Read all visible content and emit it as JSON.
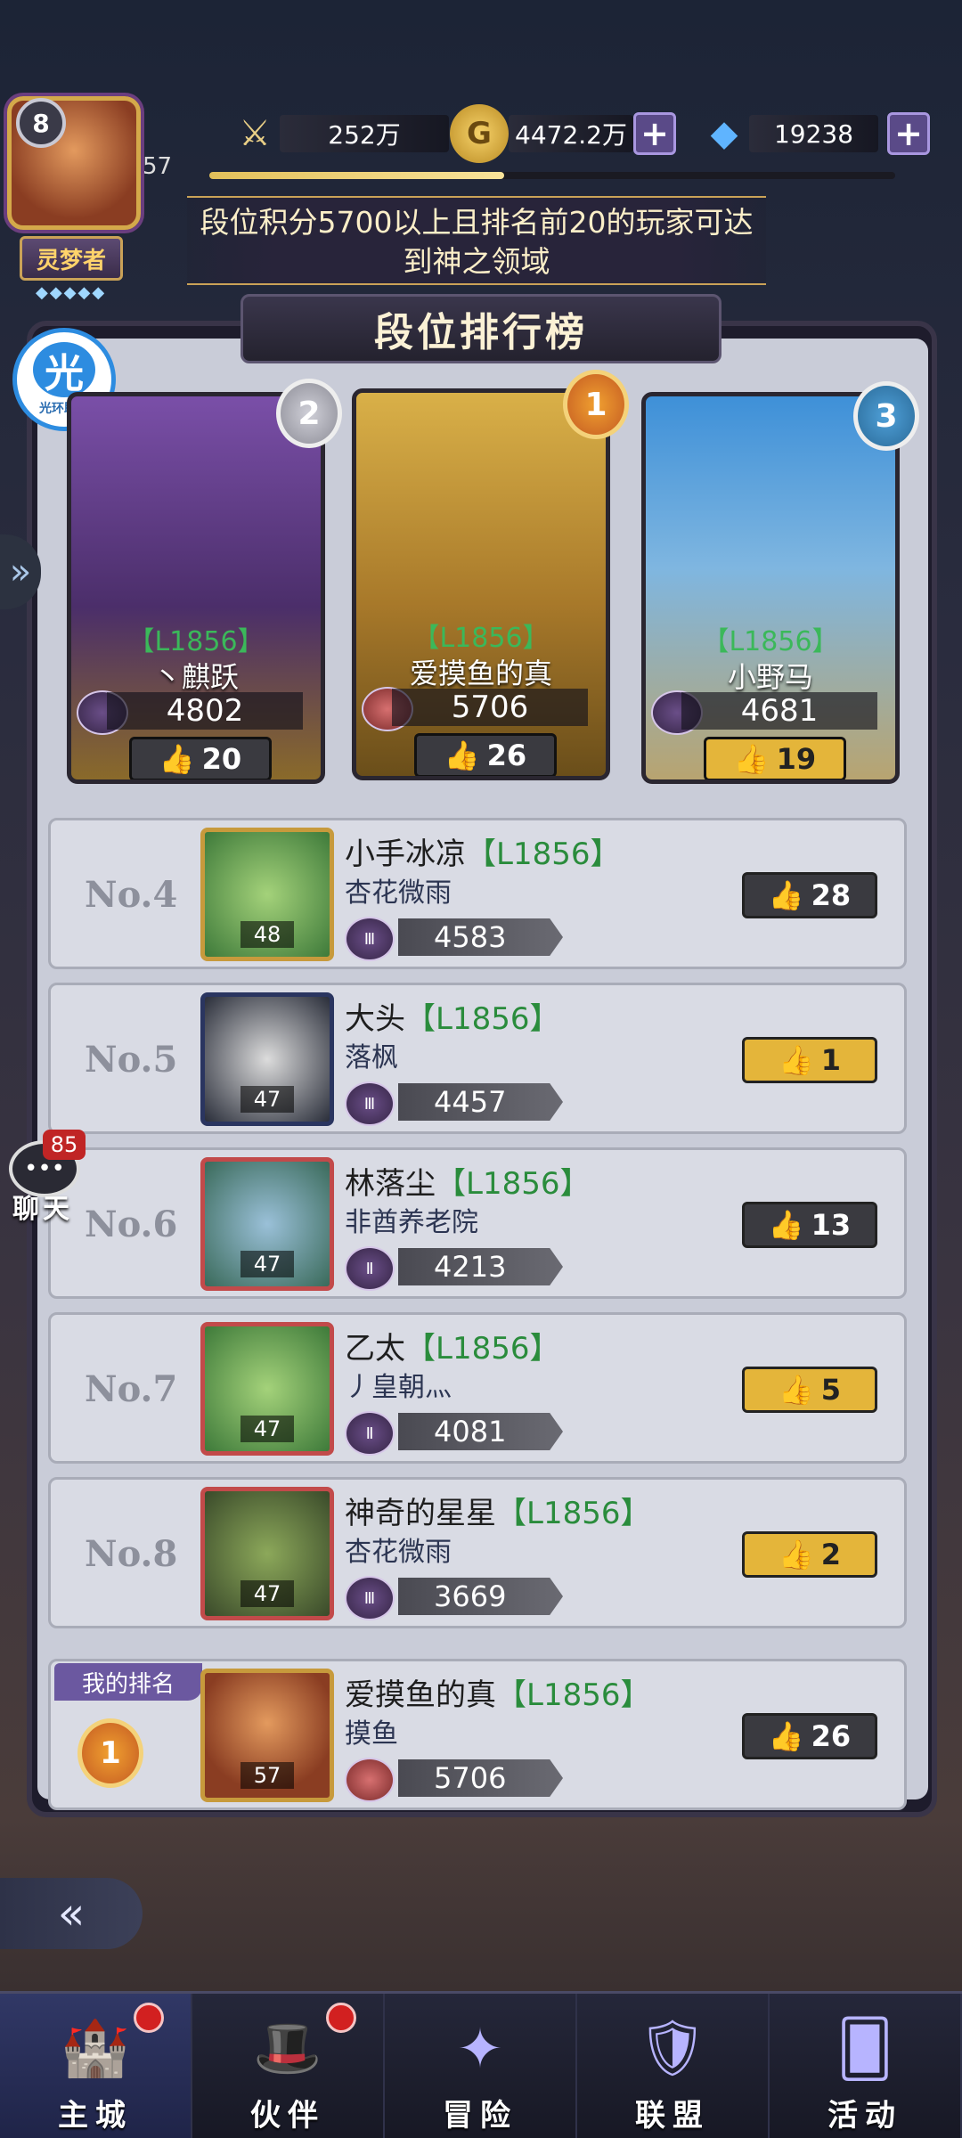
{
  "player": {
    "badge_level": "8",
    "exp_level": "57",
    "title": "灵梦者",
    "title_stars": "◆◆◆◆◆",
    "exp_progress": 0.43
  },
  "resources": {
    "power": "252万",
    "gold": "4472.2万",
    "gems": "19238",
    "plus": "+"
  },
  "notice": "段位积分5700以上且排名前20的玩家可达到神之领域",
  "panel_title": "段位排行榜",
  "helper": {
    "icon": "光",
    "label": "光环助手"
  },
  "side_arrow": "»",
  "top3": [
    {
      "rank": "2",
      "level": "【L1856】",
      "name": "丶麒跃",
      "score": "4802",
      "likes": "20",
      "like_style": "dark"
    },
    {
      "rank": "1",
      "level": "【L1856】",
      "name": "爱摸鱼的真",
      "score": "5706",
      "likes": "26",
      "like_style": "dark"
    },
    {
      "rank": "3",
      "level": "【L1856】",
      "name": "小野马",
      "score": "4681",
      "likes": "19",
      "like_style": "gold"
    }
  ],
  "rows": [
    {
      "no": "No.4",
      "name": "小手冰凉",
      "level": "【L1856】",
      "guild": "杏花微雨",
      "avatar_level": "48",
      "score": "4583",
      "likes": "28",
      "like_style": "dark",
      "tier": "Ⅲ"
    },
    {
      "no": "No.5",
      "name": "大头",
      "level": "【L1856】",
      "guild": "落枫",
      "avatar_level": "47",
      "score": "4457",
      "likes": "1",
      "like_style": "gold",
      "tier": "Ⅲ"
    },
    {
      "no": "No.6",
      "name": "林落尘",
      "level": "【L1856】",
      "guild": "非酋养老院",
      "avatar_level": "47",
      "score": "4213",
      "likes": "13",
      "like_style": "dark",
      "tier": "Ⅱ"
    },
    {
      "no": "No.7",
      "name": "乙太",
      "level": "【L1856】",
      "guild": "丿皇朝灬",
      "avatar_level": "47",
      "score": "4081",
      "likes": "5",
      "like_style": "gold",
      "tier": "Ⅱ"
    },
    {
      "no": "No.8",
      "name": "神奇的星星",
      "level": "【L1856】",
      "guild": "杏花微雨",
      "avatar_level": "47",
      "score": "3669",
      "likes": "2",
      "like_style": "gold",
      "tier": "Ⅲ"
    }
  ],
  "my_rank": {
    "tag": "我的排名",
    "rank": "1",
    "name": "爱摸鱼的真",
    "level": "【L1856】",
    "guild": "摸鱼",
    "avatar_level": "57",
    "score": "5706",
    "likes": "26"
  },
  "chat": {
    "count": "85",
    "label": "聊天",
    "icon": "•••"
  },
  "back": "«",
  "like_icon": "👍",
  "nav": [
    {
      "label": "主城",
      "icon": "🏰",
      "dot": true
    },
    {
      "label": "伙伴",
      "icon": "🎩",
      "dot": true
    },
    {
      "label": "冒险",
      "icon": "✦",
      "dot": false
    },
    {
      "label": "联盟",
      "icon": "🛡",
      "dot": false
    },
    {
      "label": "活动",
      "icon": "🂠",
      "dot": false
    }
  ]
}
